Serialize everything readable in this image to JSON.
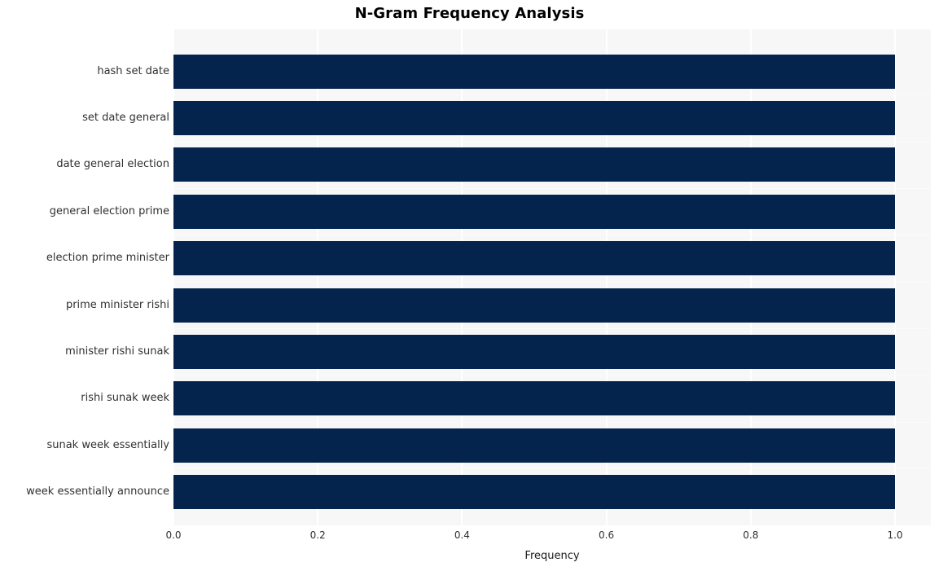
{
  "chart_data": {
    "type": "bar",
    "orientation": "horizontal",
    "title": "N-Gram Frequency Analysis",
    "xlabel": "Frequency",
    "ylabel": "",
    "categories": [
      "hash set date",
      "set date general",
      "date general election",
      "general election prime",
      "election prime minister",
      "prime minister rishi",
      "minister rishi sunak",
      "rishi sunak week",
      "sunak week essentially",
      "week essentially announce"
    ],
    "values": [
      1.0,
      1.0,
      1.0,
      1.0,
      1.0,
      1.0,
      1.0,
      1.0,
      1.0,
      1.0
    ],
    "xlim": [
      0.0,
      1.0
    ],
    "xticks": [
      "0.0",
      "0.2",
      "0.4",
      "0.6",
      "0.8",
      "1.0"
    ],
    "xtick_values": [
      0.0,
      0.2,
      0.4,
      0.6,
      0.8,
      1.0
    ],
    "grid": true,
    "legend": false,
    "bar_color": "#04244e",
    "plot_background": "#f7f7f7",
    "grid_color": "#ffffff",
    "figure_background": "#ffffff",
    "tick_label_color": "#303030",
    "title_color": "#000000"
  }
}
